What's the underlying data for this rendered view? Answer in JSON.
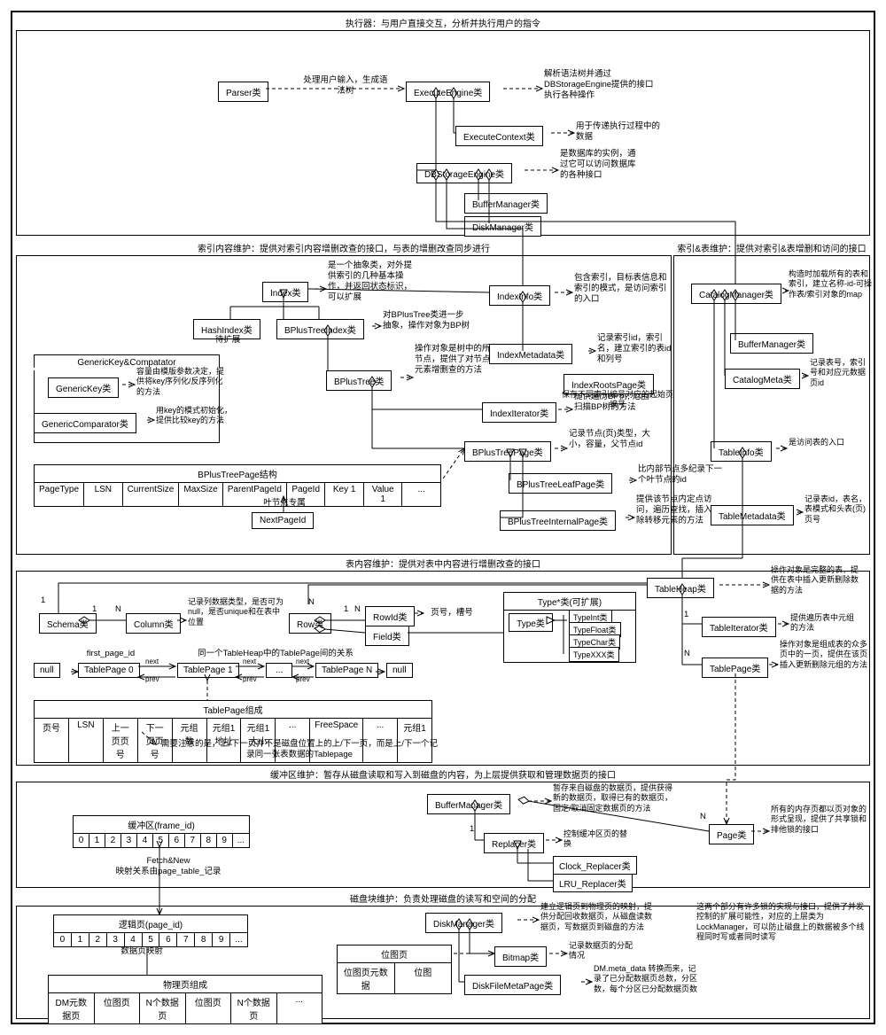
{
  "sections": {
    "executor": "执行器：与用户直接交互，分析并执行用户的指令",
    "index_maintain": "索引内容维护：提供对索引内容增删改查的接口，与表的增删改查同步进行",
    "index_table_maintain": "索引&表维护：提供对索引&表增删和访问的接口",
    "table_maintain": "表内容维护：提供对表中内容进行增删改查的接口",
    "buffer_maintain": "缓冲区维护：暂存从磁盘读取和写入到磁盘的内容，为上层提供获取和管理数据页的接口",
    "disk_maintain": "磁盘块维护：负责处理磁盘的读写和空间的分配"
  },
  "boxes": {
    "parser": "Parser类",
    "execute_engine": "ExecuteEngine类",
    "execute_context": "ExecuteContext类",
    "db_storage_engine": "DBStorageEngine类",
    "buffer_manager_top": "BufferManager类",
    "disk_manager_top": "DiskManager类",
    "index": "Index类",
    "hash_index": "HashIndex类",
    "bplus_tree_index": "BPlusTreeIndex类",
    "bplus_tree": "BPlusTree类",
    "bplus_tree_page": "BPlusTreePage类",
    "bplus_tree_leaf": "BPlusTreeLeafPage类",
    "bplus_tree_internal": "BPlusTreeInternalPage类",
    "index_iterator": "IndexIterator类",
    "index_info": "IndexInfo类",
    "index_metadata": "IndexMetadata类",
    "index_roots_page": "IndexRootsPage类",
    "catalog_manager": "CatalogManager类",
    "buffer_manager_cat": "BufferManager类",
    "catalog_meta": "CatalogMeta类",
    "table_info": "TableInfo类",
    "table_metadata": "TableMetadata类",
    "generic_key": "GenericKey类",
    "generic_comparator": "GenericComparator类",
    "gk_box_title": "GenericKey&Compatator",
    "bpt_page_struct": "BPlusTreePage结构",
    "next_page_id": "NextPageId",
    "table_heap": "TableHeap类",
    "table_iterator": "TableIterator类",
    "table_page": "TablePage类",
    "schema": "Schema类",
    "column": "Column类",
    "row": "Row类",
    "rowid": "RowId类",
    "field": "Field类",
    "type": "Type类",
    "type_star": "Type*类(可扩展)",
    "type_int": "TypeInt类",
    "type_float": "TypeFloat类",
    "type_char": "TypeChar类",
    "type_xxx": "TypeXXX类",
    "tp_struct": "TablePage组成",
    "first_page_id": "first_page_id",
    "tp0": "TablePage 0",
    "tp1": "TablePage 1",
    "tpN": "TablePage N",
    "null": "null",
    "buffer_manager": "BufferManager类",
    "replacer": "Replacer类",
    "clock_replacer": "Clock_Replacer类",
    "lru_replacer": "LRU_Replacer类",
    "page": "Page类",
    "disk_manager": "DiskManager类",
    "bitmap": "Bitmap类",
    "disk_file_meta": "DiskFileMetaPage类",
    "buffer_frame": "缓冲区(frame_id)",
    "logic_page": "逻辑页(page_id)",
    "phys_struct": "物理页组成",
    "bitmap_page": "位图页"
  },
  "notes": {
    "parser_note": "处理用户输入，生成语法树",
    "exec_engine_note": "解析语法树并通过DBStorageEngine提供的接口执行各种操作",
    "exec_context_note": "用于传递执行过程中的数据",
    "db_storage_note": "是数据库的实例，通过它可以访问数据库的各种接口",
    "index_note": "是一个抽象类，对外提供索引的几种基本操作，并返回状态标识，可以扩展",
    "hash_index_note": "待扩展",
    "bpt_index_note": "对BPlusTree类进一步抽象，操作对象为BP树",
    "bpt_note": "操作对象是树中的所有节点，提供了对节点中元素增删查的方法",
    "index_iter_note": "提供遍历BP树, 范围扫描BP树的方法",
    "bpt_page_note": "记录节点(页)类型，大小，容量，父节点id",
    "bpt_leaf_note": "比内部节点多纪录下一个叶节点的id",
    "bpt_internal_note": "提供该节点内定点访问，遍历查找，插入删除转移元素的方法",
    "index_info_note": "包含索引，目标表信息和索引的模式，是访问索引的入口",
    "index_meta_note": "记录索引id，索引名，建立索引的表id和列号",
    "index_roots_note": "保存不同索引编号对应的起始页编号",
    "catalog_mgr_note": "构造时加载所有的表和索引，建立名称-id-可操作表/索引对象的map",
    "catalog_meta_note": "记录表号，索引号和对应元数据页id",
    "table_info_note": "是访问表的入口",
    "table_meta_note": "记录表id，表名，表模式和头表(页)页号",
    "generic_key_note": "容量由模版参数决定，提供将key序列化/反序列化的方法",
    "generic_comp_note": "用key的模式初始化，提供比较key的方法",
    "leaf_note": "叶节点专属",
    "table_heap_note": "操作对象是完整的表，提供在表中插入更新删除数据的方法",
    "table_iter_note": "提供遍历表中元组的方法",
    "table_page_note": "操作对象是组成表的众多页中的一页，提供在该页插入更新删除元组的方法",
    "column_note": "记录列数据类型，是否可为null，是否unique和在表中位置",
    "rowid_note": "页号，槽号",
    "tp_relation": "同一个TableHeap中的TablePage间的关系",
    "tp_warning": "需要注意的是，上/下一页并不是磁盘位置上的上/下一页，而是上/下一个记录同一张表数据的Tablepage",
    "buffer_mgr_note": "暂存来自磁盘的数据页，提供获得新的数据页，取得已有的数据页，固定/取消固定数据页的方法",
    "replacer_note": "控制缓冲区页的替换",
    "page_note": "所有的内存页都以页对象的形式呈现，提供了共享锁和排他锁的接口",
    "fetch_new": "Fetch&New\n映射关系由page_table_记录",
    "disk_mgr_note": "建立逻辑页到物理页的映射，提供分配回收数据页，从磁盘读数据页，写数据页到磁盘的方法",
    "bitmap_note": "记录数据页的分配情况",
    "disk_meta_note": "DM.meta_data 转换而来，记录了已分配数据页总数，分区数，每个分区已分配数据页数",
    "lock_note": "这两个部分有许多锁的实现与接口，提供了并发控制的扩展可能性，对应的上层类为LockManager，可以防止磁盘上的数据被多个线程同时写或者同时读写",
    "data_page_map": "数据页映射"
  },
  "bpt_cols": [
    "PageType",
    "LSN",
    "CurrentSize",
    "MaxSize",
    "ParentPageId",
    "PageId",
    "Key 1",
    "Value 1",
    "..."
  ],
  "tp_cols": [
    "页号",
    "LSN",
    "上一页页号",
    "下一页页号",
    "元组数",
    "元组1地址",
    "元组1大小",
    "...",
    "FreeSpace",
    "...",
    "元组1"
  ],
  "bitmap_cols": [
    "位图页元数据",
    "位图"
  ],
  "phys_cols": [
    "DM元数据页",
    "位图页",
    "N个数据页",
    "位图页",
    "N个数据页",
    "..."
  ],
  "digits": [
    "0",
    "1",
    "2",
    "3",
    "4",
    "5",
    "6",
    "7",
    "8",
    "9",
    "..."
  ],
  "n1": "1",
  "nN": "N",
  "next": "next",
  "prev": "prev"
}
